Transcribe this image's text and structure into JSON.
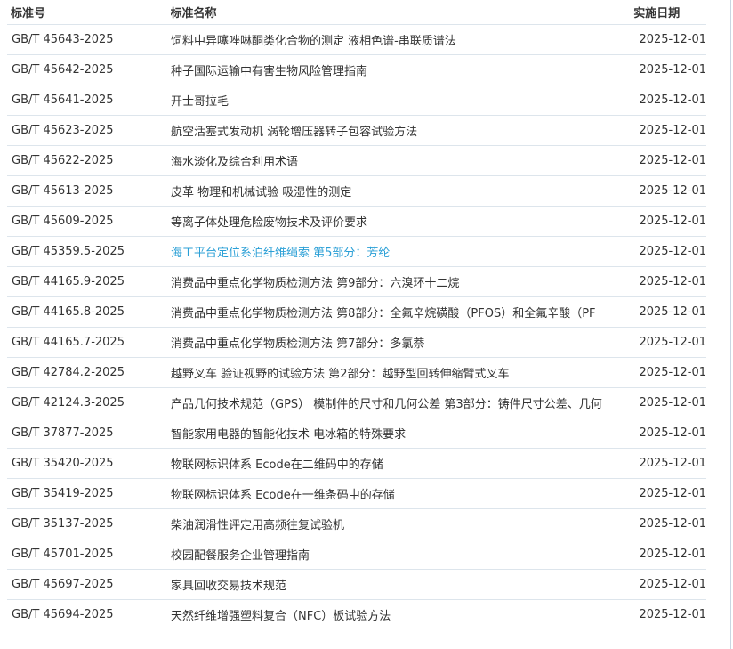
{
  "table": {
    "headers": {
      "code": "标准号",
      "name": "标准名称",
      "date": "实施日期"
    },
    "highlight_color": "#2a9fd6",
    "rows": [
      {
        "code": "GB/T 45643-2025",
        "name": "饲料中异噻唑啉酮类化合物的测定 液相色谱-串联质谱法",
        "date": "2025-12-01"
      },
      {
        "code": "GB/T 45642-2025",
        "name": "种子国际运输中有害生物风险管理指南",
        "date": "2025-12-01"
      },
      {
        "code": "GB/T 45641-2025",
        "name": "开士哥拉毛",
        "date": "2025-12-01"
      },
      {
        "code": "GB/T 45623-2025",
        "name": "航空活塞式发动机 涡轮增压器转子包容试验方法",
        "date": "2025-12-01"
      },
      {
        "code": "GB/T 45622-2025",
        "name": "海水淡化及综合利用术语",
        "date": "2025-12-01"
      },
      {
        "code": "GB/T 45613-2025",
        "name": "皮革 物理和机械试验 吸湿性的测定",
        "date": "2025-12-01"
      },
      {
        "code": "GB/T 45609-2025",
        "name": "等离子体处理危险废物技术及评价要求",
        "date": "2025-12-01"
      },
      {
        "code": "GB/T 45359.5-2025",
        "name": "海工平台定位系泊纤维绳索 第5部分：芳纶",
        "date": "2025-12-01",
        "highlight": true
      },
      {
        "code": "GB/T 44165.9-2025",
        "name": "消费品中重点化学物质检测方法 第9部分：六溴环十二烷",
        "date": "2025-12-01"
      },
      {
        "code": "GB/T 44165.8-2025",
        "name": "消费品中重点化学物质检测方法 第8部分：全氟辛烷磺酸（PFOS）和全氟辛酸（PF",
        "date": "2025-12-01"
      },
      {
        "code": "GB/T 44165.7-2025",
        "name": "消费品中重点化学物质检测方法 第7部分：多氯萘",
        "date": "2025-12-01"
      },
      {
        "code": "GB/T 42784.2-2025",
        "name": "越野叉车 验证视野的试验方法 第2部分：越野型回转伸缩臂式叉车",
        "date": "2025-12-01"
      },
      {
        "code": "GB/T 42124.3-2025",
        "name": "产品几何技术规范（GPS） 模制件的尺寸和几何公差 第3部分：铸件尺寸公差、几何",
        "date": "2025-12-01"
      },
      {
        "code": "GB/T 37877-2025",
        "name": "智能家用电器的智能化技术 电冰箱的特殊要求",
        "date": "2025-12-01"
      },
      {
        "code": "GB/T 35420-2025",
        "name": "物联网标识体系 Ecode在二维码中的存储",
        "date": "2025-12-01"
      },
      {
        "code": "GB/T 35419-2025",
        "name": "物联网标识体系 Ecode在一维条码中的存储",
        "date": "2025-12-01"
      },
      {
        "code": "GB/T 35137-2025",
        "name": "柴油润滑性评定用高频往复试验机",
        "date": "2025-12-01"
      },
      {
        "code": "GB/T 45701-2025",
        "name": "校园配餐服务企业管理指南",
        "date": "2025-12-01"
      },
      {
        "code": "GB/T 45697-2025",
        "name": "家具回收交易技术规范",
        "date": "2025-12-01"
      },
      {
        "code": "GB/T 45694-2025",
        "name": "天然纤维增强塑料复合（NFC）板试验方法",
        "date": "2025-12-01"
      }
    ]
  }
}
